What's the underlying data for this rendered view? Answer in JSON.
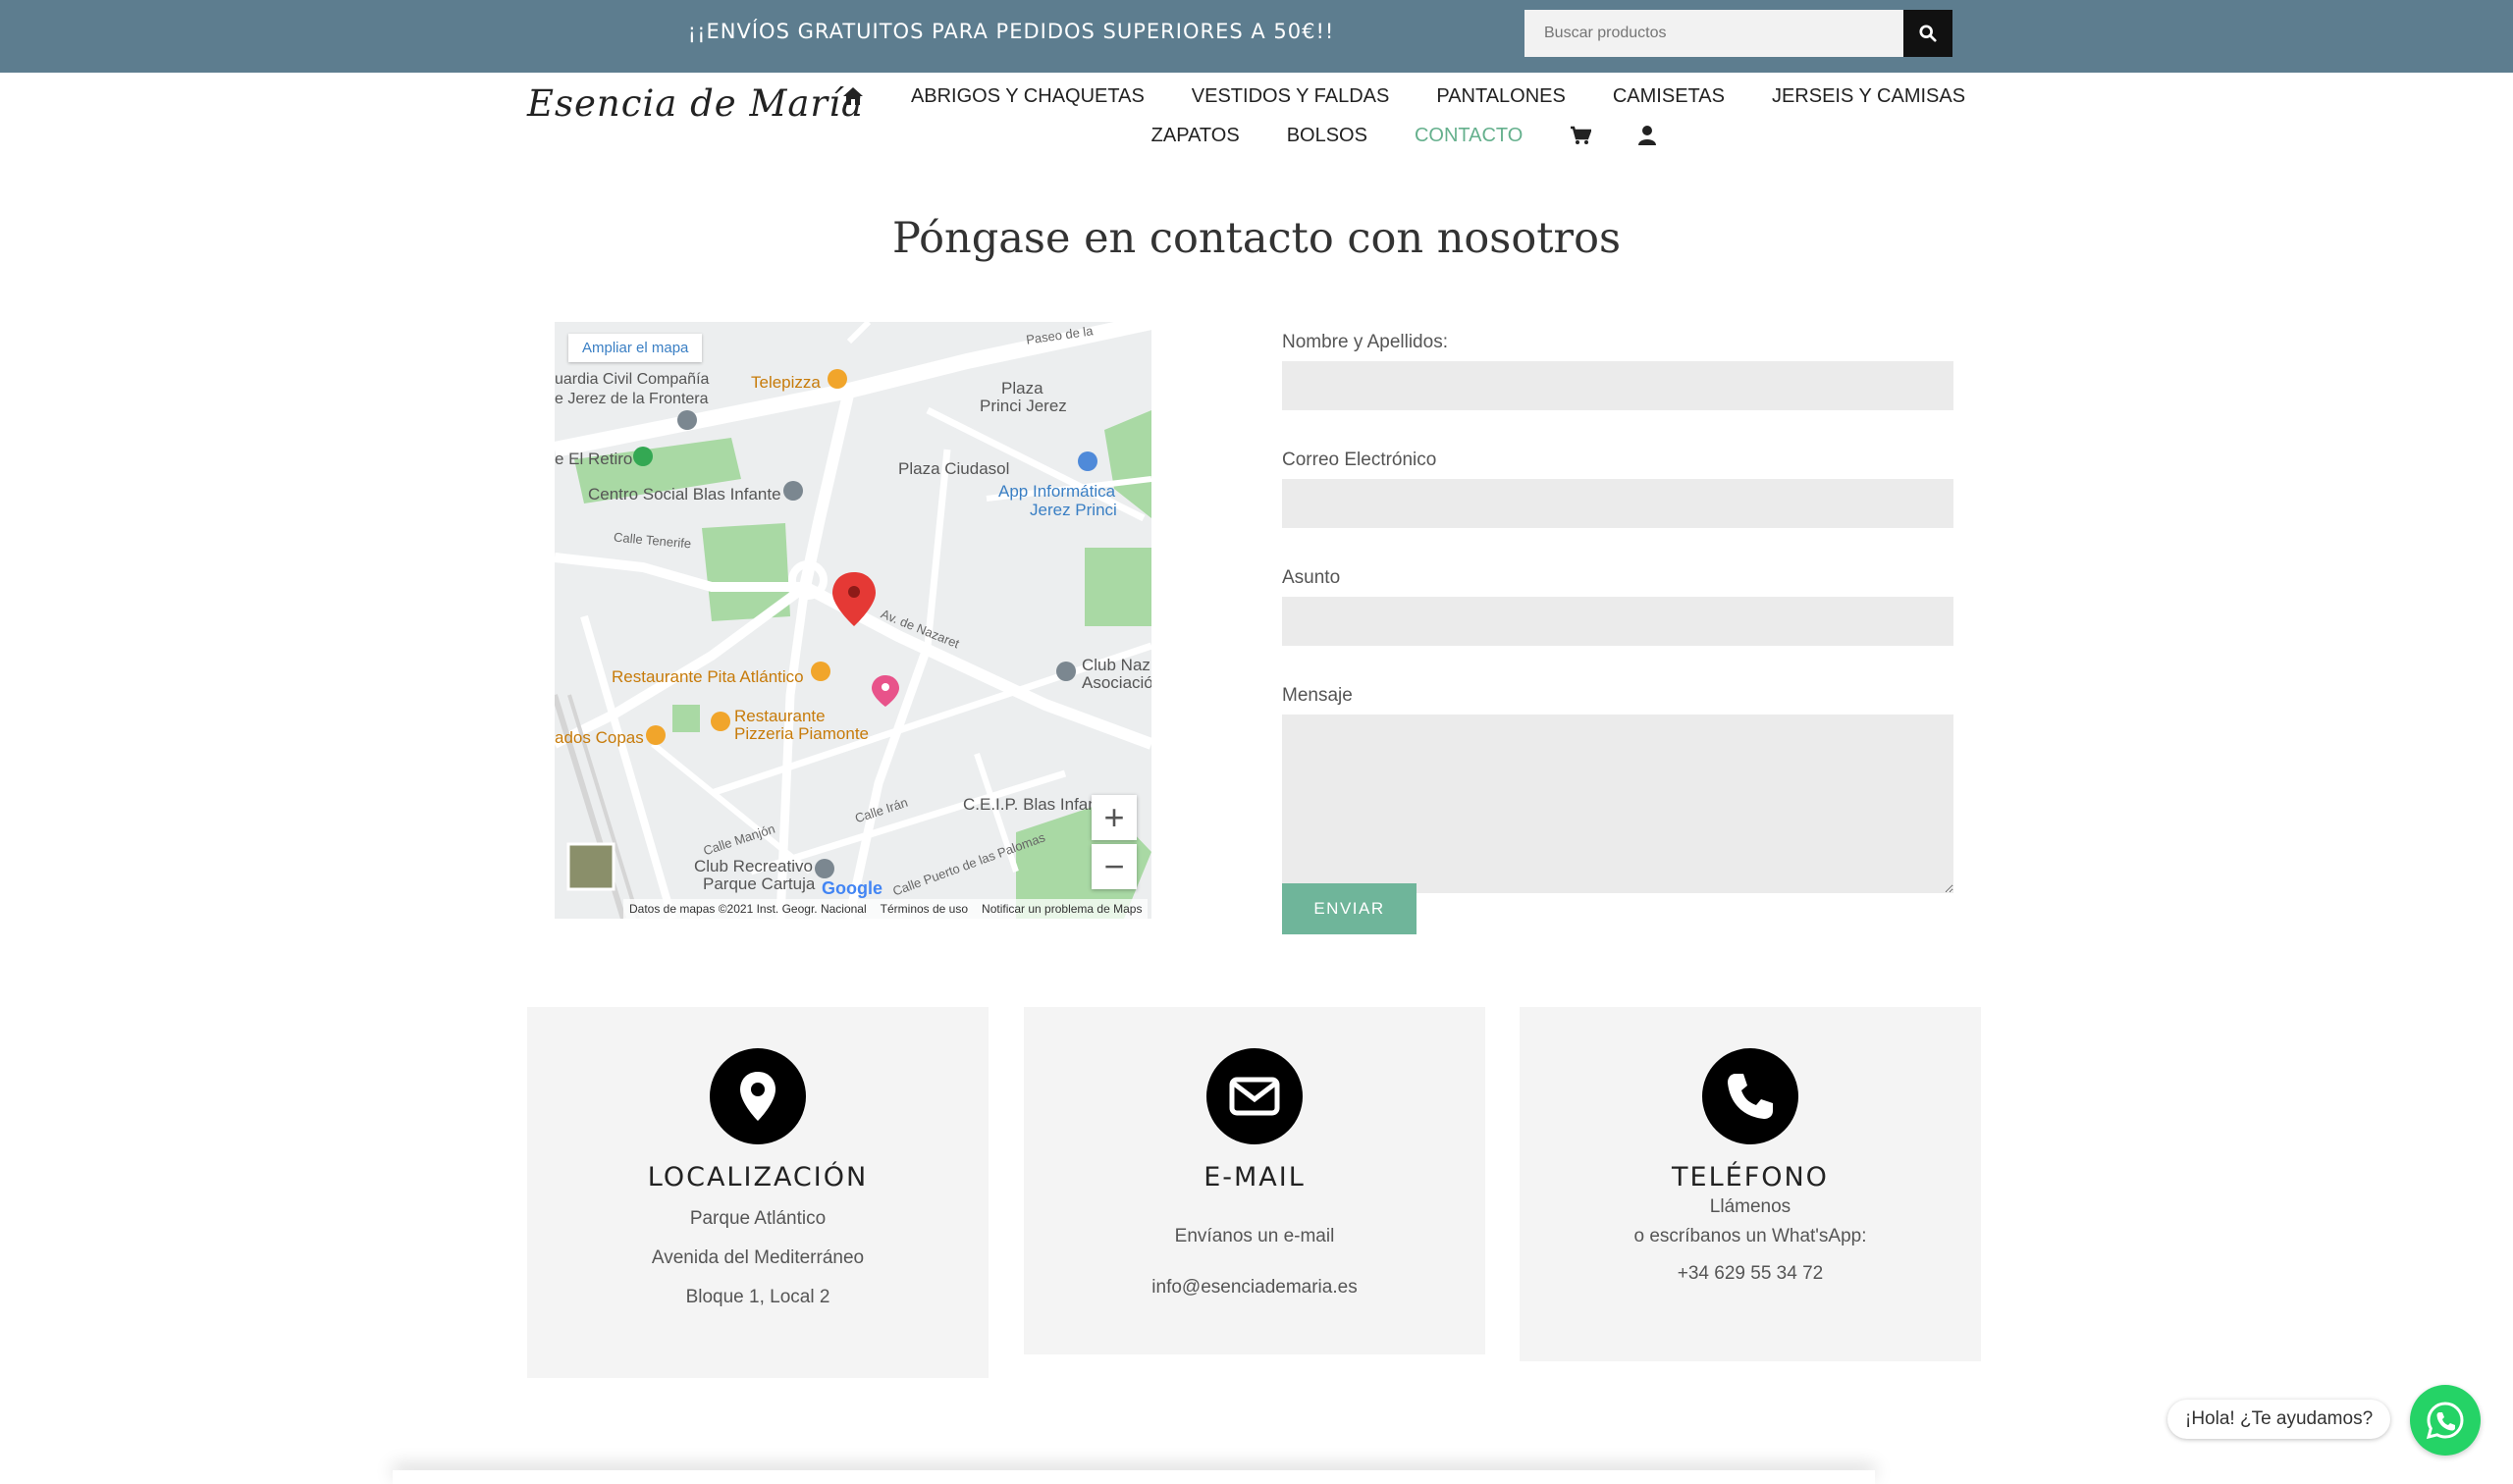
{
  "topbar": {
    "promo": "¡¡ENVÍOS GRATUITOS PARA PEDIDOS SUPERIORES A 50€!!",
    "search_placeholder": "Buscar productos"
  },
  "header": {
    "logo": "Esencia de María",
    "nav_row1": [
      "ABRIGOS Y CHAQUETAS",
      "VESTIDOS Y FALDAS",
      "PANTALONES",
      "CAMISETAS",
      "JERSEIS Y CAMISAS"
    ],
    "nav_row2": [
      "ZAPATOS",
      "BOLSOS",
      "CONTACTO"
    ]
  },
  "main": {
    "title": "Póngase en contacto con nosotros"
  },
  "map": {
    "expand_link": "Ampliar el mapa",
    "labels": {
      "guardia": "uardia Civil Compañía",
      "jerez": "e Jerez de la Frontera",
      "telepizza": "Telepizza",
      "plaza_princi": "Plaza",
      "plaza_princi2": "Princi Jerez",
      "retiro": "e El Retiro",
      "plaza_ciudasol": "Plaza Ciudasol",
      "app_informatica": "App Informática",
      "app_informatica2": "Jerez Princi",
      "centro_social": "Centro Social Blas Infante",
      "restaurante_pita": "Restaurante Pita Atlántico",
      "restaurante_pizzeria": "Restaurante",
      "restaurante_pizzeria2": "Pizzeria Piamonte",
      "copas": "ados Copas",
      "club_naz": "Club Naz",
      "club_naz2": "Asociació",
      "ceip": "C.E.I.P. Blas Infan",
      "club_recreativo": "Club Recreativo",
      "club_recreativo2": "Parque Cartuja",
      "calle_tenerife": "Calle Tenerife",
      "av_nazaret": "Av. de Nazaret",
      "calle_manjon": "Calle Manjón",
      "calle_iran": "Calle Irán",
      "calle_puerto_palomas": "Calle Puerto de las Palomas",
      "paseo": "Paseo de la",
      "google": "Google"
    },
    "footer": [
      "Datos de mapas ©2021 Inst. Geogr. Nacional",
      "Términos de uso",
      "Notificar un problema de Maps"
    ]
  },
  "form": {
    "name_label": "Nombre y Apellidos:",
    "email_label": "Correo Electrónico",
    "subject_label": "Asunto",
    "message_label": "Mensaje",
    "submit": "ENVIAR"
  },
  "cards": {
    "location": {
      "title": "LOCALIZACIÓN",
      "lines": [
        "Parque Atlántico",
        "Avenida del Mediterráneo",
        "Bloque 1, Local 2"
      ]
    },
    "email": {
      "title": "E-MAIL",
      "lines": [
        "Envíanos un e-mail",
        "info@esenciademaria.es"
      ]
    },
    "phone": {
      "title": "TELÉFONO",
      "lines": [
        "Llámenos",
        "o escríbanos un What'sApp:",
        "+34 629 55 34 72"
      ]
    }
  },
  "whatsapp": {
    "bubble": "¡Hola! ¿Te ayudamos?"
  },
  "colors": {
    "topbar": "#5d7d8f",
    "accent": "#65b08d",
    "button": "#6fb59a",
    "whatsapp": "#25d366"
  }
}
